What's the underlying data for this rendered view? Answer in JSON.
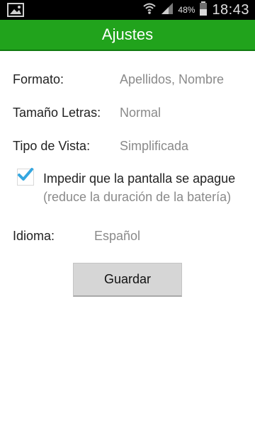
{
  "status_bar": {
    "battery_percent": "48%",
    "time": "18:43"
  },
  "header": {
    "title": "Ajustes"
  },
  "settings": {
    "format_label": "Formato:",
    "format_value": "Apellidos, Nombre",
    "font_size_label": "Tamaño Letras:",
    "font_size_value": "Normal",
    "view_type_label": "Tipo de Vista:",
    "view_type_value": "Simplificada",
    "keep_screen_on_label": "Impedir que la pantalla se apague",
    "keep_screen_on_note": "(reduce la duración de la batería)",
    "keep_screen_on_checked": true,
    "language_label": "Idioma:",
    "language_value": "Español"
  },
  "actions": {
    "save_label": "Guardar"
  },
  "colors": {
    "accent_green": "#21a31c",
    "check_blue": "#35a7e0"
  },
  "icons": {
    "gallery": "image-icon",
    "wifi": "wifi-icon",
    "signal": "signal-icon",
    "battery": "battery-icon",
    "check": "check-icon"
  }
}
